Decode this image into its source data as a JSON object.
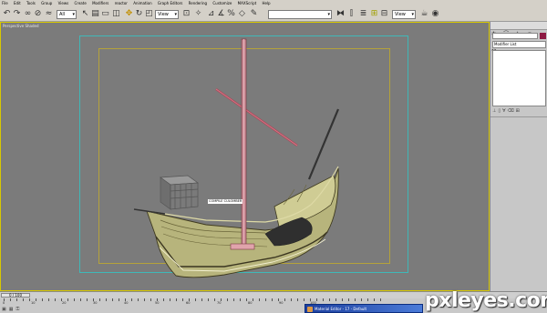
{
  "menu": [
    "File",
    "Edit",
    "Tools",
    "Group",
    "Views",
    "Create",
    "Modifiers",
    "reactor",
    "Animation",
    "Graph Editors",
    "Rendering",
    "Customize",
    "MAXScript",
    "Help"
  ],
  "toolbar": {
    "selection_filter": "All",
    "ref_coord": "View",
    "named_selection": "",
    "view_select": "View",
    "icons": [
      "undo-icon",
      "redo-icon",
      "link-icon",
      "unlink-icon",
      "bind-icon",
      "select-icon",
      "select-by-name-icon",
      "rect-region-icon",
      "window-crossing-icon",
      "move-icon",
      "rotate-icon",
      "scale-icon",
      "pivot-icon",
      "select-manipulate-icon",
      "snap-icon",
      "angle-snap-icon",
      "percent-snap-icon",
      "spinner-snap-icon",
      "edit-named-icon",
      "mirror-icon",
      "align-icon",
      "layer-icon",
      "curve-editor-icon",
      "schematic-icon",
      "material-editor-icon",
      "render-scene-icon",
      "quick-render-icon"
    ]
  },
  "viewport": {
    "label": "Perspective Shaded",
    "ship_label": "COMPILE CULOMBER"
  },
  "command_panel": {
    "modifier_list": "Modifier List",
    "swatch_color": "#8e1a43"
  },
  "timeline": {
    "slider": "0 / 100",
    "ticks": [
      "0",
      "10",
      "20",
      "30",
      "40",
      "50",
      "60",
      "70",
      "80",
      "90",
      "100"
    ]
  },
  "taskbar": {
    "material_editor": "Material Editor - 17 - Default"
  },
  "watermark": "pxleyes.com"
}
